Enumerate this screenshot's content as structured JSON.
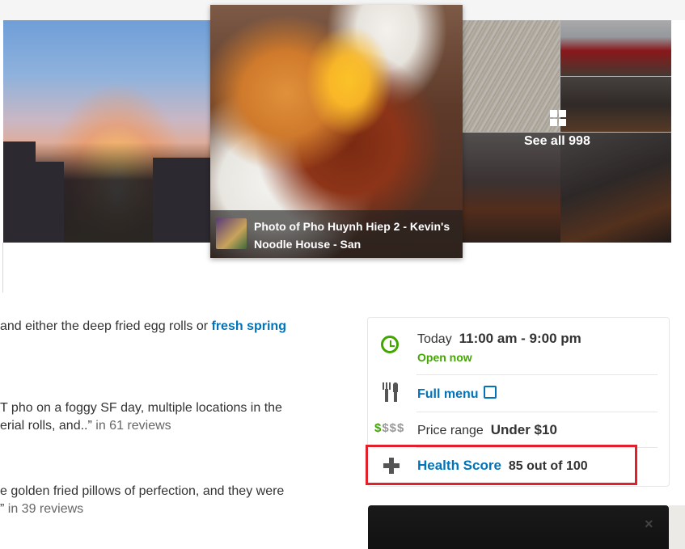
{
  "gallery": {
    "featured_caption": "Photo of Pho Huynh Hiep 2 - Kevin's Noodle House - San",
    "see_all_label": "See all 998"
  },
  "reviews": [
    {
      "text_before": "and either the deep fried egg rolls or ",
      "highlight": "fresh spring",
      "count_label": ""
    },
    {
      "line1": "T pho on a foggy SF day, multiple locations in the",
      "line2": "erial rolls, and..”",
      "count_label": " in 61 reviews"
    },
    {
      "line1": "e golden fried pillows of perfection, and they were",
      "line2": "”",
      "count_label": " in 39 reviews"
    }
  ],
  "info": {
    "hours_day": "Today",
    "hours_range": "11:00 am - 9:00 pm",
    "open_status": "Open now",
    "menu_label": "Full menu",
    "price_icon_on": "$",
    "price_icon_off": "$$$",
    "price_label": "Price range",
    "price_value": "Under $10",
    "health_label": "Health Score",
    "health_value": "85 out of 100"
  },
  "ad_panel": {
    "close_glyph": "×"
  },
  "colors": {
    "link": "#0073bb",
    "open": "#41a700",
    "highlight_border": "#e0202a"
  }
}
